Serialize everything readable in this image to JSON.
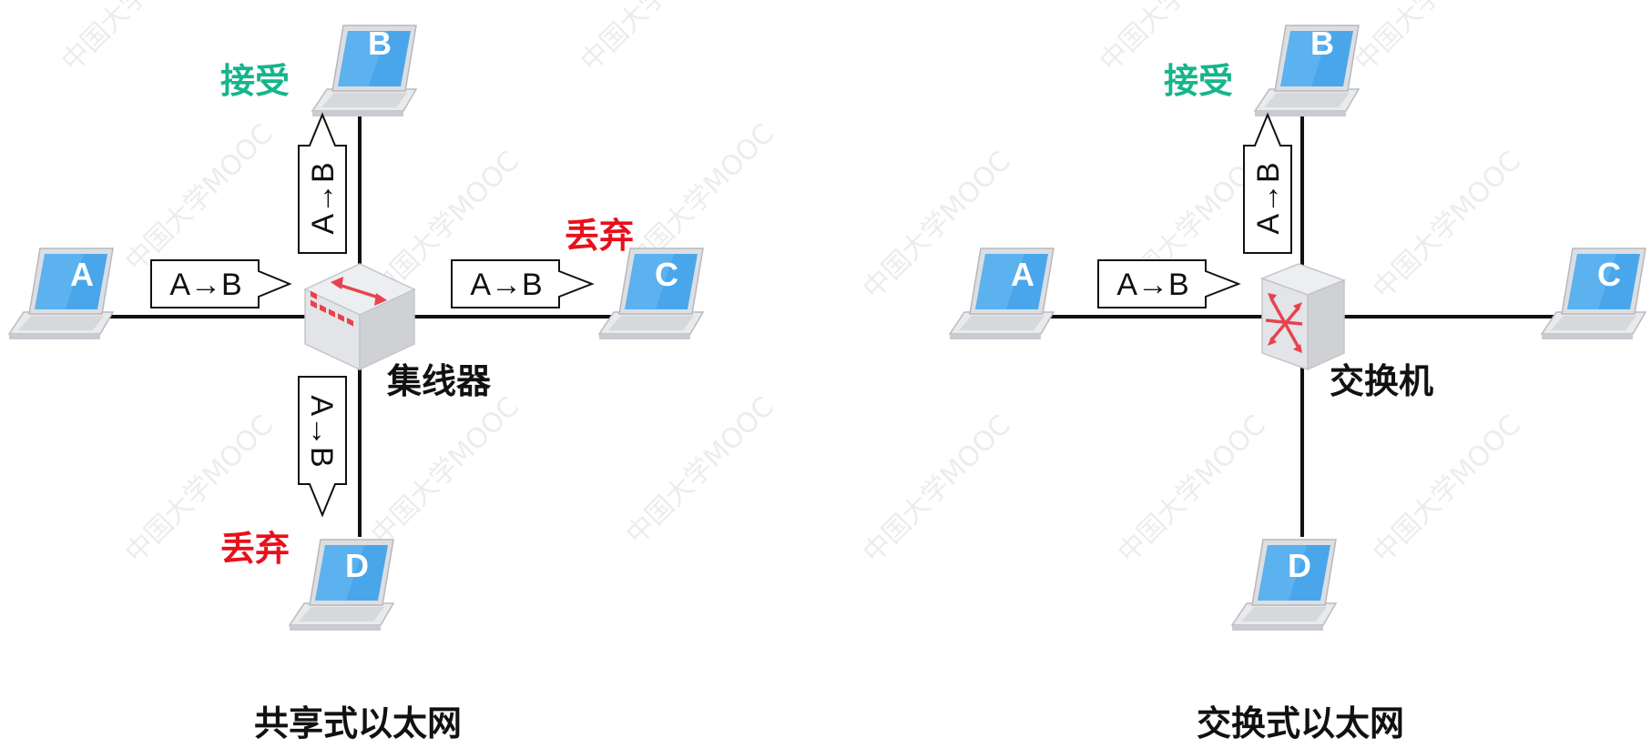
{
  "left_diagram": {
    "device_label": "集线器",
    "caption": "共享式以太网",
    "hosts": [
      "A",
      "B",
      "C",
      "D"
    ],
    "frame_label": "A→B",
    "status_b": "接受",
    "status_c": "丢弃",
    "status_d": "丢弃"
  },
  "right_diagram": {
    "device_label": "交换机",
    "caption": "交换式以太网",
    "hosts": [
      "A",
      "B",
      "C",
      "D"
    ],
    "frame_label": "A→B",
    "status_b": "接受"
  },
  "watermark": "中国大学MOOC",
  "colors": {
    "accept": "#16b58a",
    "discard": "#e8101b",
    "screen": "#4aa6ea",
    "device": "#d7d8dc",
    "device_mark": "#e8424f"
  },
  "icons": {
    "hub": "hub-icon",
    "switch": "switch-icon",
    "laptop": "laptop-icon"
  }
}
